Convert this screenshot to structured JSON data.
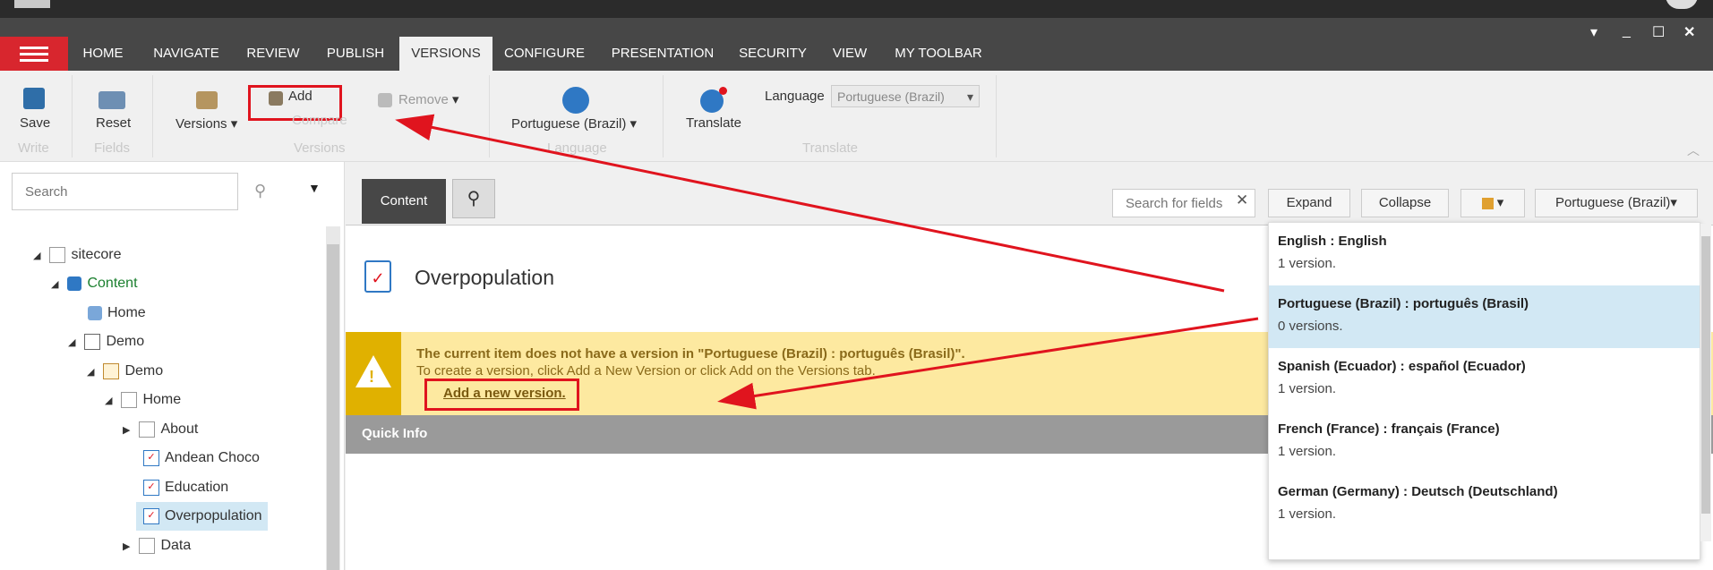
{
  "ribbon_tabs": [
    "HOME",
    "NAVIGATE",
    "REVIEW",
    "PUBLISH",
    "VERSIONS",
    "CONFIGURE",
    "PRESENTATION",
    "SECURITY",
    "VIEW",
    "MY TOOLBAR"
  ],
  "ribbon": {
    "save": "Save",
    "write_group": "Write",
    "reset": "Reset",
    "fields_group": "Fields",
    "versions": "Versions",
    "add": "Add",
    "compare": "Compare",
    "remove": "Remove",
    "versions_group": "Versions",
    "language_button": "Portuguese (Brazil)",
    "language_group": "Language",
    "translate": "Translate",
    "language_label": "Language",
    "language_select": "Portuguese (Brazil)",
    "translate_group": "Translate"
  },
  "left": {
    "search_placeholder": "Search",
    "tree": [
      "sitecore",
      "Content",
      "Home",
      "Demo",
      "Demo",
      "Home",
      "About",
      "Andean Choco",
      "Education",
      "Overpopulation",
      "Data"
    ]
  },
  "editor": {
    "tab_content": "Content",
    "search_fields_placeholder": "Search for fields",
    "expand": "Expand",
    "collapse": "Collapse",
    "language_selector": "Portuguese (Brazil)",
    "item_title": "Overpopulation",
    "warning_line1": "The current item does not have a version in \"Portuguese (Brazil) : português (Brasil)\".",
    "warning_line2": "To create a version, click Add a New Version or click Add on the Versions tab.",
    "warning_link": "Add a new version.",
    "quick_info": "Quick Info"
  },
  "languages": [
    {
      "name": "English : English",
      "count": "1 version."
    },
    {
      "name": "Portuguese (Brazil) : português (Brasil)",
      "count": "0 versions."
    },
    {
      "name": "Spanish (Ecuador) : español (Ecuador)",
      "count": "1 version."
    },
    {
      "name": "French (France) : français (France)",
      "count": "1 version."
    },
    {
      "name": "German (Germany) : Deutsch (Deutschland)",
      "count": "1 version."
    }
  ],
  "colors": {
    "accent_red": "#d8262e",
    "annotation_red": "#e0141e",
    "warning_bg": "#fde9a0",
    "selected_bg": "#d2e8f4"
  }
}
